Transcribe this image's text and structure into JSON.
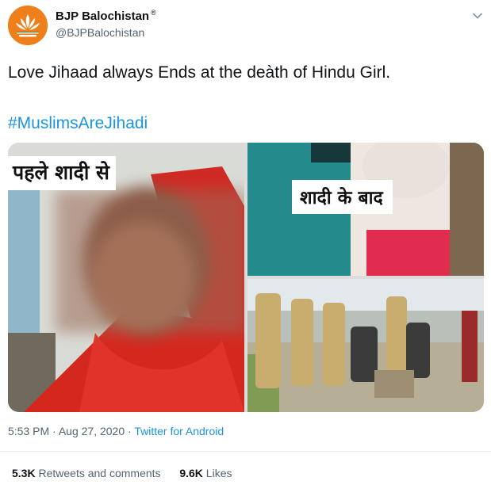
{
  "account": {
    "display_name": "BJP Balochistan",
    "registered_mark": "®",
    "handle": "@BJPBalochistan",
    "avatar_icon": "lotus-logo-icon",
    "avatar_color": "#ef7f1a"
  },
  "menu": {
    "icon": "chevron-down-icon"
  },
  "tweet": {
    "text": "Love Jihaad always Ends at the deàth of Hindu Girl.",
    "hashtag": "#MuslimsAreJihadi"
  },
  "media": {
    "left_caption": "पहले शादी से",
    "right_caption": "शादी के बाद"
  },
  "meta": {
    "time": "5:53 PM",
    "separator": "·",
    "date": "Aug 27, 2020",
    "source": "Twitter for Android"
  },
  "stats": {
    "retweets_count": "5.3K",
    "retweets_label": "Retweets and comments",
    "likes_count": "9.6K",
    "likes_label": "Likes"
  },
  "colors": {
    "link": "#1b95e0",
    "secondary_text": "#536471",
    "primary_text": "#0f1419"
  }
}
